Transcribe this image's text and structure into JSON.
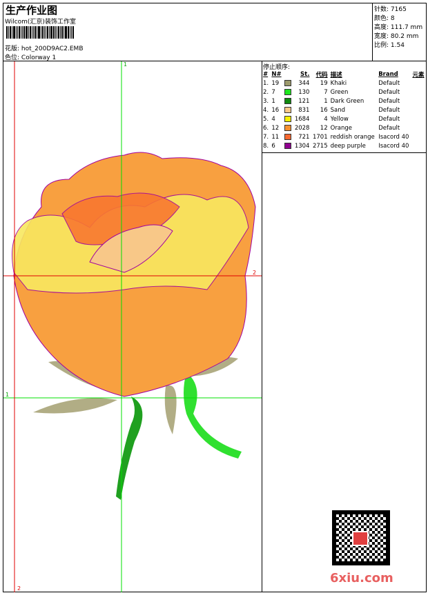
{
  "header": {
    "title": "生产作业图",
    "company": "Wilcom(汇京)装饰工作室",
    "design_label": "花版:",
    "design": "hot_200D9AC2.EMB",
    "colorway_label": "色位:",
    "colorway": "Colorway 1"
  },
  "info": [
    {
      "label": "针数:",
      "value": "7165"
    },
    {
      "label": "颜色:",
      "value": "8"
    },
    {
      "label": "高度:",
      "value": "111.7 mm"
    },
    {
      "label": "宽度:",
      "value": "80.2 mm"
    },
    {
      "label": "比例:",
      "value": "1.54"
    }
  ],
  "stops": {
    "title": "停止顺序:",
    "headers": [
      "#",
      "N#",
      "St.",
      "代码",
      "描述",
      "Brand",
      "元素"
    ],
    "rows": [
      {
        "idx": "1.",
        "n": "19",
        "color": "#9c9a6c",
        "st": "344",
        "code": "19",
        "desc": "Khaki",
        "brand": "Default"
      },
      {
        "idx": "2.",
        "n": "7",
        "color": "#1ee61e",
        "st": "130",
        "code": "7",
        "desc": "Green",
        "brand": "Default"
      },
      {
        "idx": "3.",
        "n": "1",
        "color": "#108a10",
        "st": "121",
        "code": "1",
        "desc": "Dark Green",
        "brand": "Default"
      },
      {
        "idx": "4.",
        "n": "16",
        "color": "#f8c888",
        "st": "831",
        "code": "16",
        "desc": "Sand",
        "brand": "Default"
      },
      {
        "idx": "5.",
        "n": "4",
        "color": "#f8f000",
        "st": "1684",
        "code": "4",
        "desc": "Yellow",
        "brand": "Default"
      },
      {
        "idx": "6.",
        "n": "12",
        "color": "#f89030",
        "st": "2028",
        "code": "12",
        "desc": "Orange",
        "brand": "Default"
      },
      {
        "idx": "7.",
        "n": "11",
        "color": "#f86830",
        "st": "721",
        "code": "1701",
        "desc": "reddish orange",
        "brand": "Isacord 40"
      },
      {
        "idx": "8.",
        "n": "6",
        "color": "#900090",
        "st": "1304",
        "code": "2715",
        "desc": "deep purple",
        "brand": "Isacord 40"
      }
    ]
  },
  "guides": {
    "v1": "1",
    "h2": "2",
    "h1": "1",
    "v2": "2"
  },
  "watermark": "6xiu.com"
}
